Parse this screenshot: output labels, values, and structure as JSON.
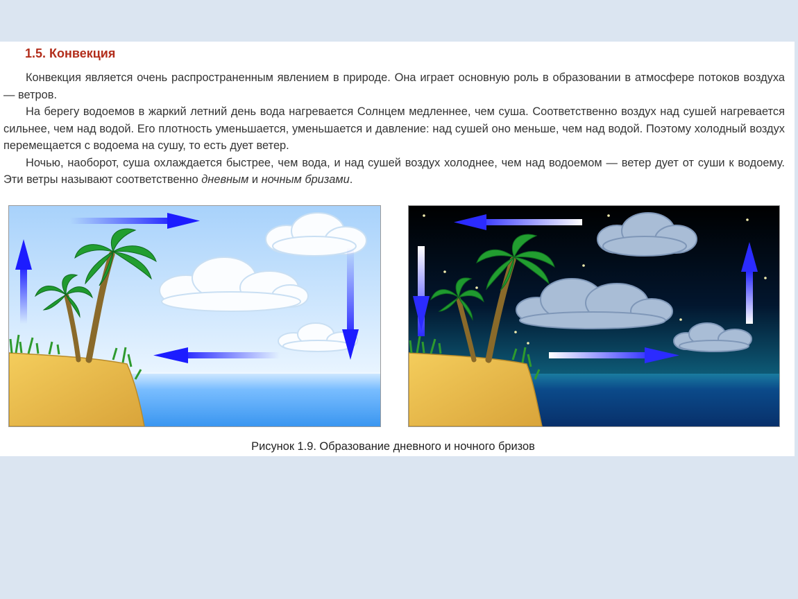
{
  "heading": "1.5. Конвекция",
  "paragraphs": {
    "p1": "Конвекция является очень распространенным явлением в природе. Она играет основную роль в образовании в атмосфере потоков воздуха — ветров.",
    "p2": "На берегу водоемов в жаркий летний день вода нагревается Солнцем медленнее, чем суша. Соответственно воздух над сушей нагревается сильнее, чем над водой. Его плотность уменьшается, уменьшается и давление: над сушей оно меньше, чем над водой. Поэтому холодный воздух перемещается с водоема на сушу, то есть дует ветер.",
    "p3_start": "Ночью, наоборот, суша охлаждается быстрее, чем вода, и над сушей воздух холоднее, чем над водоемом — ветер дует от суши к водоему. Эти ветры называют соответственно ",
    "p3_em1": "дневным",
    "p3_mid": " и ",
    "p3_em2": "ночным бризами",
    "p3_end": "."
  },
  "caption": "Рисунок 1.9. Образование дневного и ночного бризов",
  "colors": {
    "heading": "#b22d1b",
    "background": "#dbe5f1",
    "arrow": "#2020ff",
    "sand": "#e8b84a",
    "day_sea": "#4aa3ff",
    "night_sea": "#0a3f7a"
  }
}
